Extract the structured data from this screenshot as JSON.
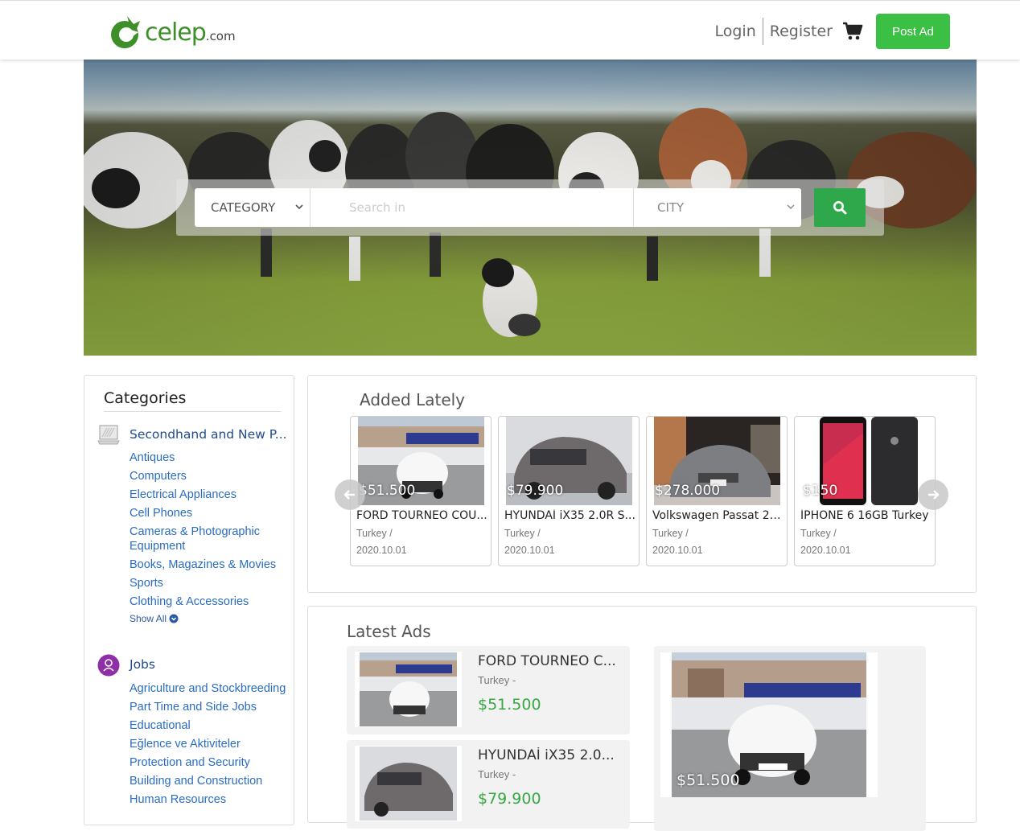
{
  "header": {
    "logo_text": "celep",
    "logo_suffix": ".com",
    "login": "Login",
    "register": "Register",
    "post_ad": "Post Ad"
  },
  "search": {
    "category_label": "CATEGORY",
    "input_placeholder": "Search in",
    "city_label": "CITY"
  },
  "categories": {
    "title": "Categories",
    "groups": [
      {
        "title": "Secondhand and New P...",
        "icon": "laptop-icon",
        "items": [
          "Antiques",
          "Computers",
          "Electrical Appliances",
          "Cell Phones",
          "Cameras & Photographic Equipment",
          "Books, Magazines & Movies",
          "Sports",
          "Clothing & Accessories"
        ],
        "show_all": "Show All"
      },
      {
        "title": "Jobs",
        "icon": "worker-icon",
        "items": [
          "Agriculture and Stockbreeding",
          "Part Time and Side Jobs",
          "Educational",
          "Eğlence ve Aktiviteler",
          "Protection and Security",
          "Building and Construction",
          "Human Resources"
        ]
      }
    ]
  },
  "added_lately": {
    "title": "Added Lately",
    "cards": [
      {
        "price": "$51.500",
        "name": "FORD TOURNEO COU...",
        "location": "Turkey /",
        "date": "2020.10.01"
      },
      {
        "price": "$79.900",
        "name": "HYUNDAİ iX35 2.0R S...",
        "location": "Turkey /",
        "date": "2020.10.01"
      },
      {
        "price": "$278.000",
        "name": "Volkswagen Passat 20...",
        "location": "Turkey /",
        "date": "2020.10.01"
      },
      {
        "price": "$150",
        "name": "İPHONE 6 16GB Turkey",
        "location": "Turkey /",
        "date": "2020.10.01"
      }
    ]
  },
  "latest_ads": {
    "title": "Latest Ads",
    "items": [
      {
        "name": "FORD TOURNEO C...",
        "location": "Turkey -",
        "price": "$51.500"
      },
      {
        "name": "HYUNDAİ iX35 2.0...",
        "location": "Turkey -",
        "price": "$79.900"
      }
    ],
    "featured_price": "$51.500"
  },
  "colors": {
    "brand_green": "#3cbf45",
    "search_green": "#2ea84a",
    "price_green": "#35a843",
    "link_blue": "#2a6cc2"
  }
}
